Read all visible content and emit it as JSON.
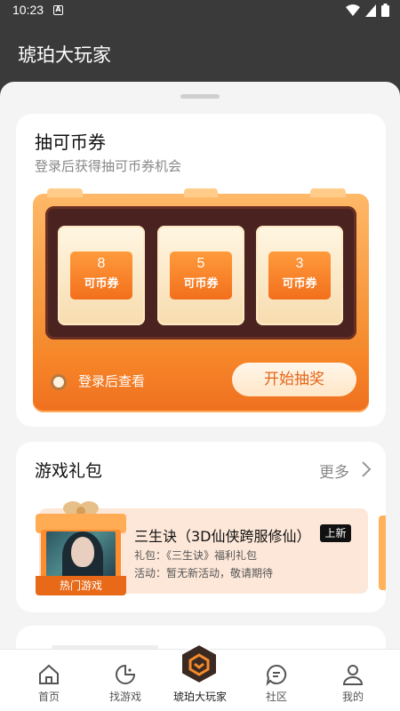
{
  "status_bar": {
    "time": "10:23",
    "notification_glyph": "A"
  },
  "app": {
    "title": "琥珀大玩家"
  },
  "lottery": {
    "title": "抽可币券",
    "subtitle": "登录后获得抽可币券机会",
    "tickets": [
      {
        "value": "8",
        "label": "可币券"
      },
      {
        "value": "5",
        "label": "可币券"
      },
      {
        "value": "3",
        "label": "可币券"
      }
    ],
    "view_label": "登录后查看",
    "draw_button": "开始抽奖"
  },
  "gifts": {
    "title": "游戏礼包",
    "more_label": "更多",
    "item": {
      "name": "三生诀（3D仙侠跨服修仙）",
      "badge": "上新",
      "box_label": "热门游戏",
      "gift_line": "礼包：《三生诀》福利礼包",
      "activity_line": "活动：暂无新活动，敬请期待"
    }
  },
  "nav": [
    {
      "label": "首页",
      "icon": "home-icon"
    },
    {
      "label": "找游戏",
      "icon": "game-search-icon"
    },
    {
      "label": "琥珀大玩家",
      "icon": "app-logo-icon"
    },
    {
      "label": "社区",
      "icon": "chat-icon"
    },
    {
      "label": "我的",
      "icon": "profile-icon"
    }
  ],
  "colors": {
    "accent": "#f47a22",
    "header_bg": "#3a3a3a",
    "sheet_bg": "#f4f4f4"
  }
}
